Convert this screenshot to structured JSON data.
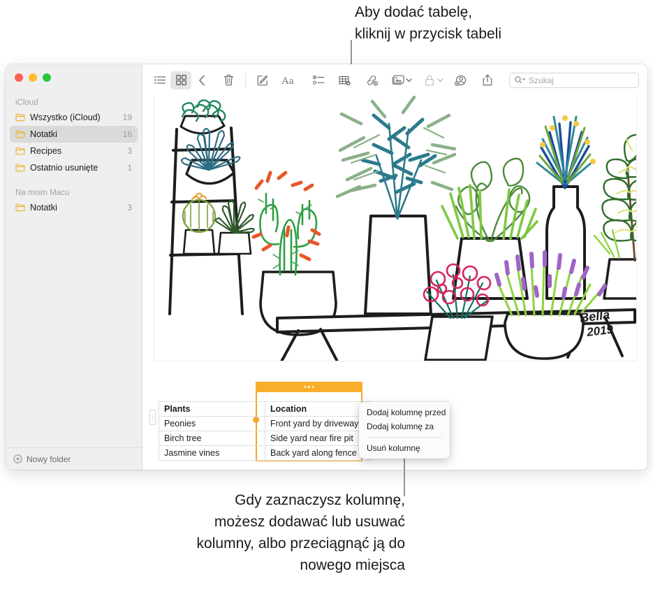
{
  "callouts": {
    "top": "Aby dodać tabelę,\nkliknij w przycisk tabeli",
    "bottom": "Gdy zaznaczysz kolumnę,\nmożesz dodawać lub usuwać\nkolumny, albo przeciągnąć ją do\nnowego miejsca"
  },
  "sidebar": {
    "sections": [
      {
        "label": "iCloud",
        "items": [
          {
            "label": "Wszystko (iCloud)",
            "count": "19",
            "selected": false
          },
          {
            "label": "Notatki",
            "count": "16",
            "selected": true
          },
          {
            "label": "Recipes",
            "count": "3",
            "selected": false
          },
          {
            "label": "Ostatnio usunięte",
            "count": "1",
            "selected": false
          }
        ]
      },
      {
        "label": "Na moim Macu",
        "items": [
          {
            "label": "Notatki",
            "count": "3",
            "selected": false
          }
        ]
      }
    ],
    "new_folder_label": "Nowy folder"
  },
  "toolbar": {
    "icons": [
      "list-view-icon",
      "grid-view-icon",
      "back-chevron-icon",
      "trash-icon",
      "compose-note-icon",
      "text-format-icon",
      "checklist-icon",
      "table-icon",
      "link-icon",
      "media-icon",
      "lock-icon",
      "share-collaborate-icon",
      "share-icon"
    ],
    "active_view": "grid-view-icon"
  },
  "search": {
    "placeholder": "Szukaj",
    "value": ""
  },
  "note": {
    "drawing_signature": "Bella 2019",
    "table": {
      "headers": [
        "Plants",
        "Location"
      ],
      "rows": [
        [
          "Peonies",
          "Front yard by driveway"
        ],
        [
          "Birch tree",
          "Side yard near fire pit"
        ],
        [
          "Jasmine vines",
          "Back yard along fence"
        ]
      ],
      "selected_column_index": 1,
      "selection_color": "#f5a623"
    }
  },
  "context_menu": {
    "items": [
      {
        "label": "Dodaj kolumnę przed",
        "type": "item"
      },
      {
        "label": "Dodaj kolumnę za",
        "type": "item"
      },
      {
        "label": "",
        "type": "divider"
      },
      {
        "label": "Usuń kolumnę",
        "type": "item"
      }
    ]
  },
  "colors": {
    "accent_orange": "#f5a623",
    "sidebar_bg": "#f0eff0",
    "selected_row": "#dbdadb"
  }
}
